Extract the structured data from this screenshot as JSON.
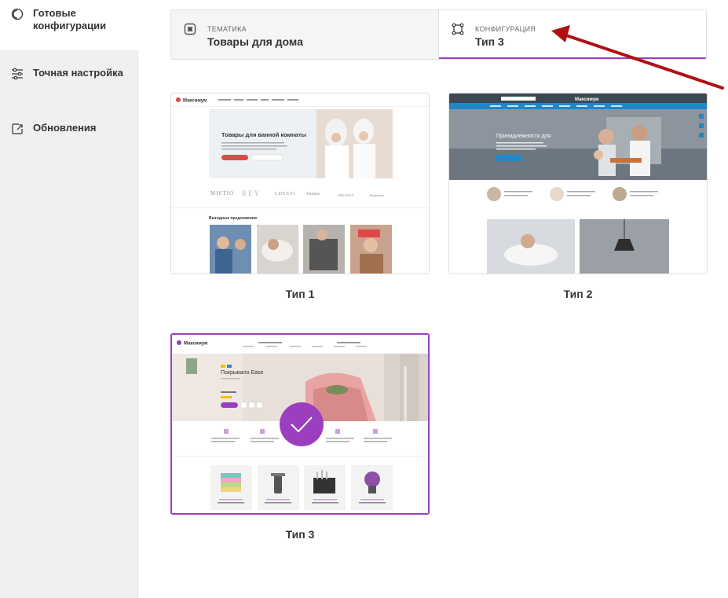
{
  "sidebar": {
    "items": [
      {
        "label": "Готовые конфигурации",
        "icon": "ready-configs-icon",
        "active": true
      },
      {
        "label": "Точная настройка",
        "icon": "sliders-icon",
        "active": false
      },
      {
        "label": "Обновления",
        "icon": "update-icon",
        "active": false
      }
    ]
  },
  "tabs": [
    {
      "kicker": "ТЕМАТИКА",
      "value": "Товары для дома",
      "icon": "theme-icon",
      "active": false
    },
    {
      "kicker": "КОНФИГУРАЦИЯ",
      "value": "Тип 3",
      "icon": "config-icon",
      "active": true
    }
  ],
  "configs": [
    {
      "caption": "Тип 1",
      "selected": false,
      "preview": {
        "logo": "Максимум",
        "hero_title": "Товары для ванной комнаты",
        "brands": [
          "MISTIO",
          "REY",
          "LDESTI",
          "Techline",
          "GRACEFUL",
          "Андромеда"
        ],
        "section_title": "Выгодные предложения"
      }
    },
    {
      "caption": "Тип 2",
      "selected": false,
      "preview": {
        "logo": "Максимум",
        "hero_title": "Принадлежности для"
      }
    },
    {
      "caption": "Тип 3",
      "selected": true,
      "preview": {
        "logo": "Максимум",
        "product_title": "Покрывало Ease"
      }
    }
  ],
  "colors": {
    "accent": "#9c3fbf",
    "annotation_arrow": "#b01010",
    "sidebar_bg": "#f0f0f0"
  }
}
